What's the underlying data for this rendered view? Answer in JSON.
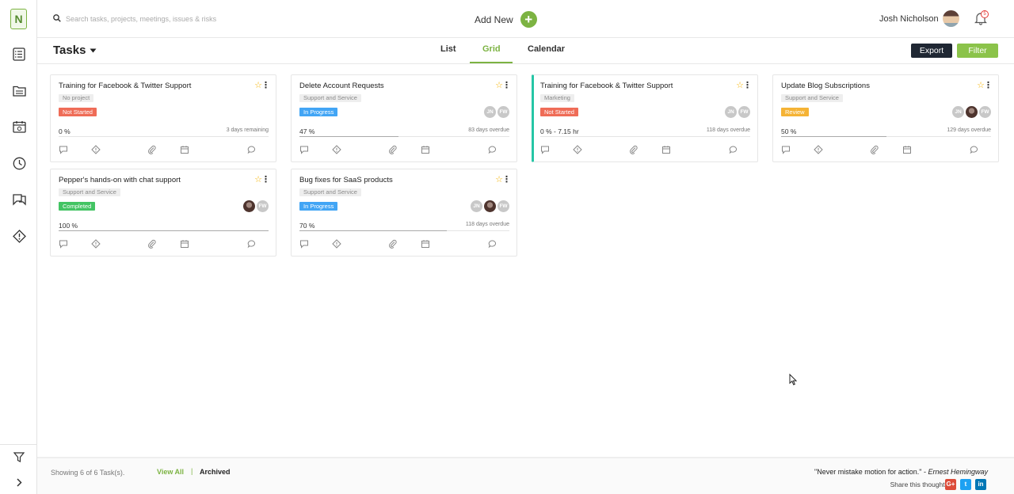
{
  "topbar": {
    "search_placeholder": "Search tasks, projects, meetings, issues & risks",
    "add_new_label": "Add New",
    "add_icon": "+",
    "user_name": "Josh Nicholson",
    "notification_count": "5"
  },
  "sidebar": {
    "logo_text": "N",
    "items": [
      "tasks-icon",
      "projects-icon",
      "meetings-icon",
      "timesheet-icon",
      "issues-icon",
      "risks-icon"
    ]
  },
  "subheader": {
    "title": "Tasks",
    "tabs": [
      {
        "label": "List",
        "active": false
      },
      {
        "label": "Grid",
        "active": true
      },
      {
        "label": "Calendar",
        "active": false
      }
    ],
    "export_label": "Export",
    "filter_label": "Filter"
  },
  "cards": [
    {
      "title": "Training for Facebook & Twitter Support",
      "project": "No project",
      "status": "Not Started",
      "status_color": "#ef6c57",
      "avatars": [],
      "progress_text": "0 %",
      "progress": 0,
      "due": "3 days remaining",
      "highlight": false
    },
    {
      "title": "Delete Account Requests",
      "project": "Support and Service",
      "status": "In Progress",
      "status_color": "#42a5f5",
      "avatars": [
        "JN",
        "FW"
      ],
      "progress_text": "47 %",
      "progress": 47,
      "due": "83 days overdue",
      "highlight": false
    },
    {
      "title": "Training for Facebook & Twitter Support",
      "project": "Marketing",
      "status": "Not Started",
      "status_color": "#ef6c57",
      "avatars": [
        "JN",
        "FW"
      ],
      "progress_text": "0 % - 7.15 hr",
      "progress": 0,
      "due": "118 days overdue",
      "highlight": true
    },
    {
      "title": "Update Blog Subscriptions",
      "project": "Support and Service",
      "status": "Review",
      "status_color": "#f5b335",
      "avatars": [
        "JN",
        "photo",
        "FW"
      ],
      "progress_text": "50 %",
      "progress": 50,
      "due": "129 days overdue",
      "highlight": false
    },
    {
      "title": "Pepper's hands-on with chat support",
      "project": "Support and Service",
      "status": "Completed",
      "status_color": "#43c463",
      "avatars": [
        "photo",
        "FW"
      ],
      "progress_text": "100 %",
      "progress": 100,
      "due": "",
      "highlight": false
    },
    {
      "title": "Bug fixes for SaaS products",
      "project": "Support and Service",
      "status": "In Progress",
      "status_color": "#42a5f5",
      "avatars": [
        "JN",
        "photo",
        "FW"
      ],
      "progress_text": "70 %",
      "progress": 70,
      "due": "118 days overdue",
      "highlight": false
    }
  ],
  "footer": {
    "showing_text": "Showing 6 of 6 Task(s).",
    "view_all": "View All",
    "separator": "|",
    "archived": "Archived",
    "quote_text": "\"Never mistake motion for action.\" - ",
    "quote_author": "Ernest Hemingway",
    "share_label": "Share this thought:",
    "social": [
      {
        "name": "google-plus",
        "glyph": "G+",
        "color": "#dd4b39"
      },
      {
        "name": "twitter",
        "glyph": "t",
        "color": "#1da1f2"
      },
      {
        "name": "linkedin",
        "glyph": "in",
        "color": "#0077b5"
      }
    ]
  },
  "colors": {
    "accent": "#7cb342",
    "dark_button": "#1f2733",
    "highlight_border": "#26c6a6"
  }
}
